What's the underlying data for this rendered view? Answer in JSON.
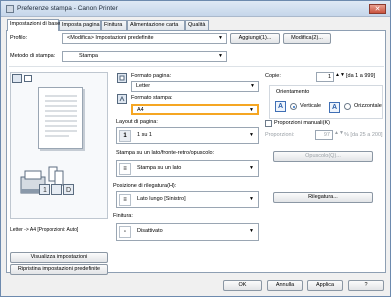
{
  "window": {
    "title": "Preferenze stampa - Canon Printer",
    "close_symbol": "✕"
  },
  "tabs": [
    {
      "label": "Impostazioni di base",
      "active": true
    },
    {
      "label": "Imposta pagina",
      "active": false
    },
    {
      "label": "Finitura",
      "active": false
    },
    {
      "label": "Alimentazione carta",
      "active": false
    },
    {
      "label": "Qualità",
      "active": false
    }
  ],
  "profile": {
    "label": "Profilo:",
    "value": "<Modifica> Impostazioni predefinite",
    "add_button": "Aggiungi(1)...",
    "edit_button": "Modifica(2)..."
  },
  "output_method": {
    "label": "Metodo di stampa:",
    "value": "Stampa"
  },
  "preview": {
    "caption": "Letter -> A4 [Proporzioni: Auto]"
  },
  "left_buttons": {
    "view_settings": "Visualizza impostazioni",
    "restore_defaults": "Ripristina impostazioni predefinite"
  },
  "page_size": {
    "label": "Formato pagina:",
    "value": "Letter"
  },
  "output_size": {
    "label": "Formato stampa:",
    "value": "A4"
  },
  "copies": {
    "label": "Copie:",
    "value": "1",
    "range": "[da 1 a 999]"
  },
  "orientation": {
    "label": "Orientamento",
    "portrait_icon": "A",
    "portrait": "Verticale",
    "landscape_icon": "A",
    "landscape": "Orizzontale",
    "selected": "portrait"
  },
  "page_layout": {
    "label": "Layout di pagina:",
    "value": "1 su 1",
    "icon_text": "1"
  },
  "manual_scaling": {
    "label": "Proporzioni manuali(K)",
    "checked": false,
    "scaling_label": "Proporzioni:",
    "scaling_value": "97",
    "scaling_range": "% [da 25 a 200]"
  },
  "duplex": {
    "label": "Stampa su un lato/fronte-retro/opuscolo:",
    "value": "Stampa su un lato",
    "booklet_button": "Opuscolo(Q)..."
  },
  "binding": {
    "label": "Posizione di rilegatura(H):",
    "value": "Lato lungo [Sinistro]",
    "gutter_button": "Rilegatura..."
  },
  "finishing": {
    "label": "Finitura:",
    "value": "Disattivato"
  },
  "footer": {
    "ok": "OK",
    "cancel": "Annulla",
    "apply": "Applica",
    "help": "?"
  },
  "colors": {
    "accent": "#2a6ec3",
    "highlight": "#f5a623"
  }
}
